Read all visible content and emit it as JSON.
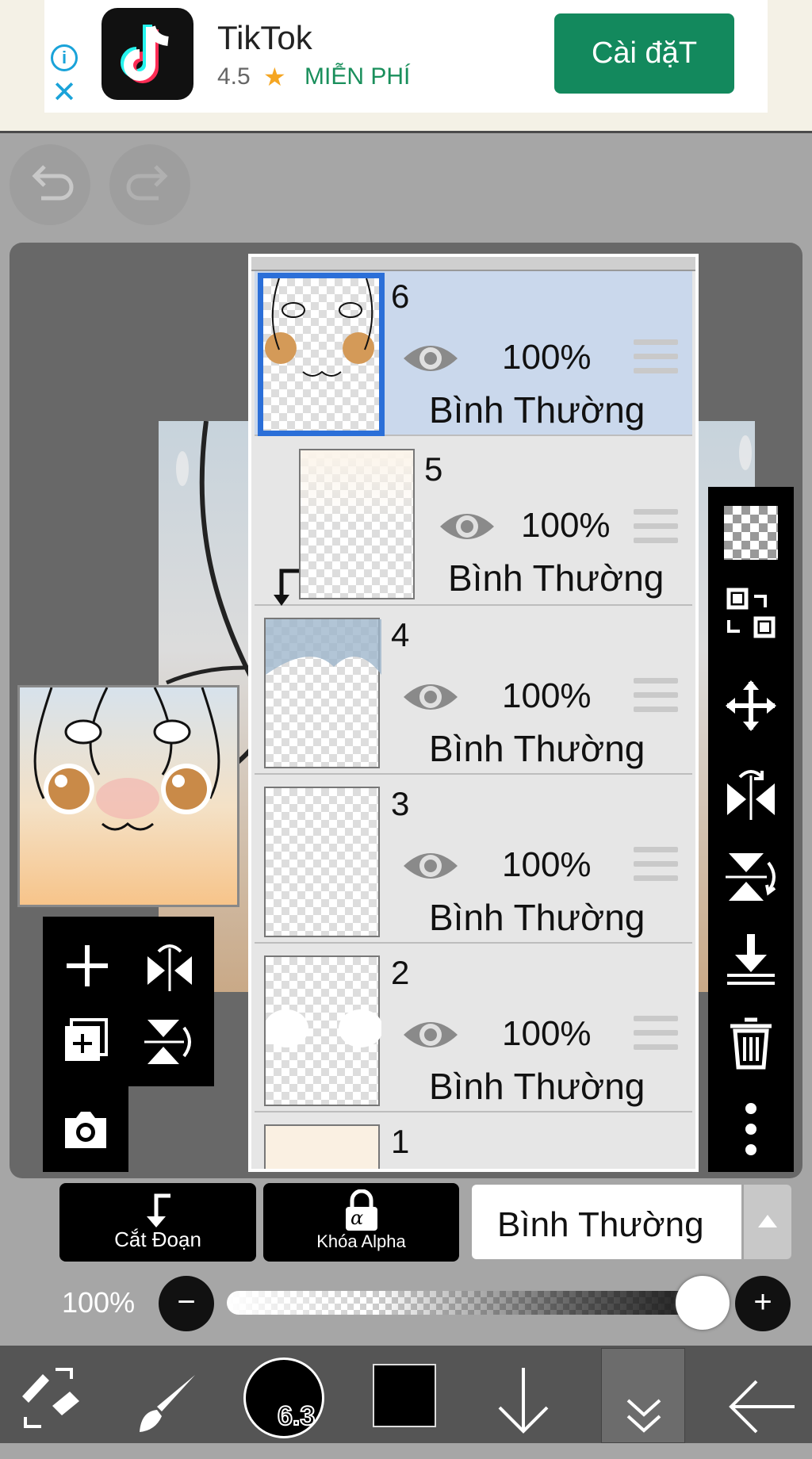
{
  "ad": {
    "app_name": "TikTok",
    "rating": "4.5",
    "price": "MIỄN PHÍ",
    "install_label": "Cài đặT",
    "info_icon": "info-icon",
    "close_icon": "close-icon"
  },
  "toolbar_top": {
    "undo_icon": "undo-icon",
    "redo_icon": "redo-icon"
  },
  "layers": [
    {
      "number": "6",
      "opacity": "100%",
      "mode": "Bình Thường",
      "selected": true
    },
    {
      "number": "5",
      "opacity": "100%",
      "mode": "Bình Thường",
      "clipped": true
    },
    {
      "number": "4",
      "opacity": "100%",
      "mode": "Bình Thường"
    },
    {
      "number": "3",
      "opacity": "100%",
      "mode": "Bình Thường"
    },
    {
      "number": "2",
      "opacity": "100%",
      "mode": "Bình Thường"
    },
    {
      "number": "1"
    }
  ],
  "layer_controls": {
    "clip_label": "Cắt Đoạn",
    "alpha_label": "Khóa Alpha",
    "alpha_glyph": "α",
    "blend_mode": "Bình Thường",
    "opacity_label": "100%",
    "minus": "−",
    "plus": "+"
  },
  "bottom_bar": {
    "brush_size": "6.3",
    "color": "#000000"
  },
  "colors": {
    "accent": "#2b6fd8",
    "selected_layer": "#cad8ec",
    "install_green": "#13895d"
  }
}
